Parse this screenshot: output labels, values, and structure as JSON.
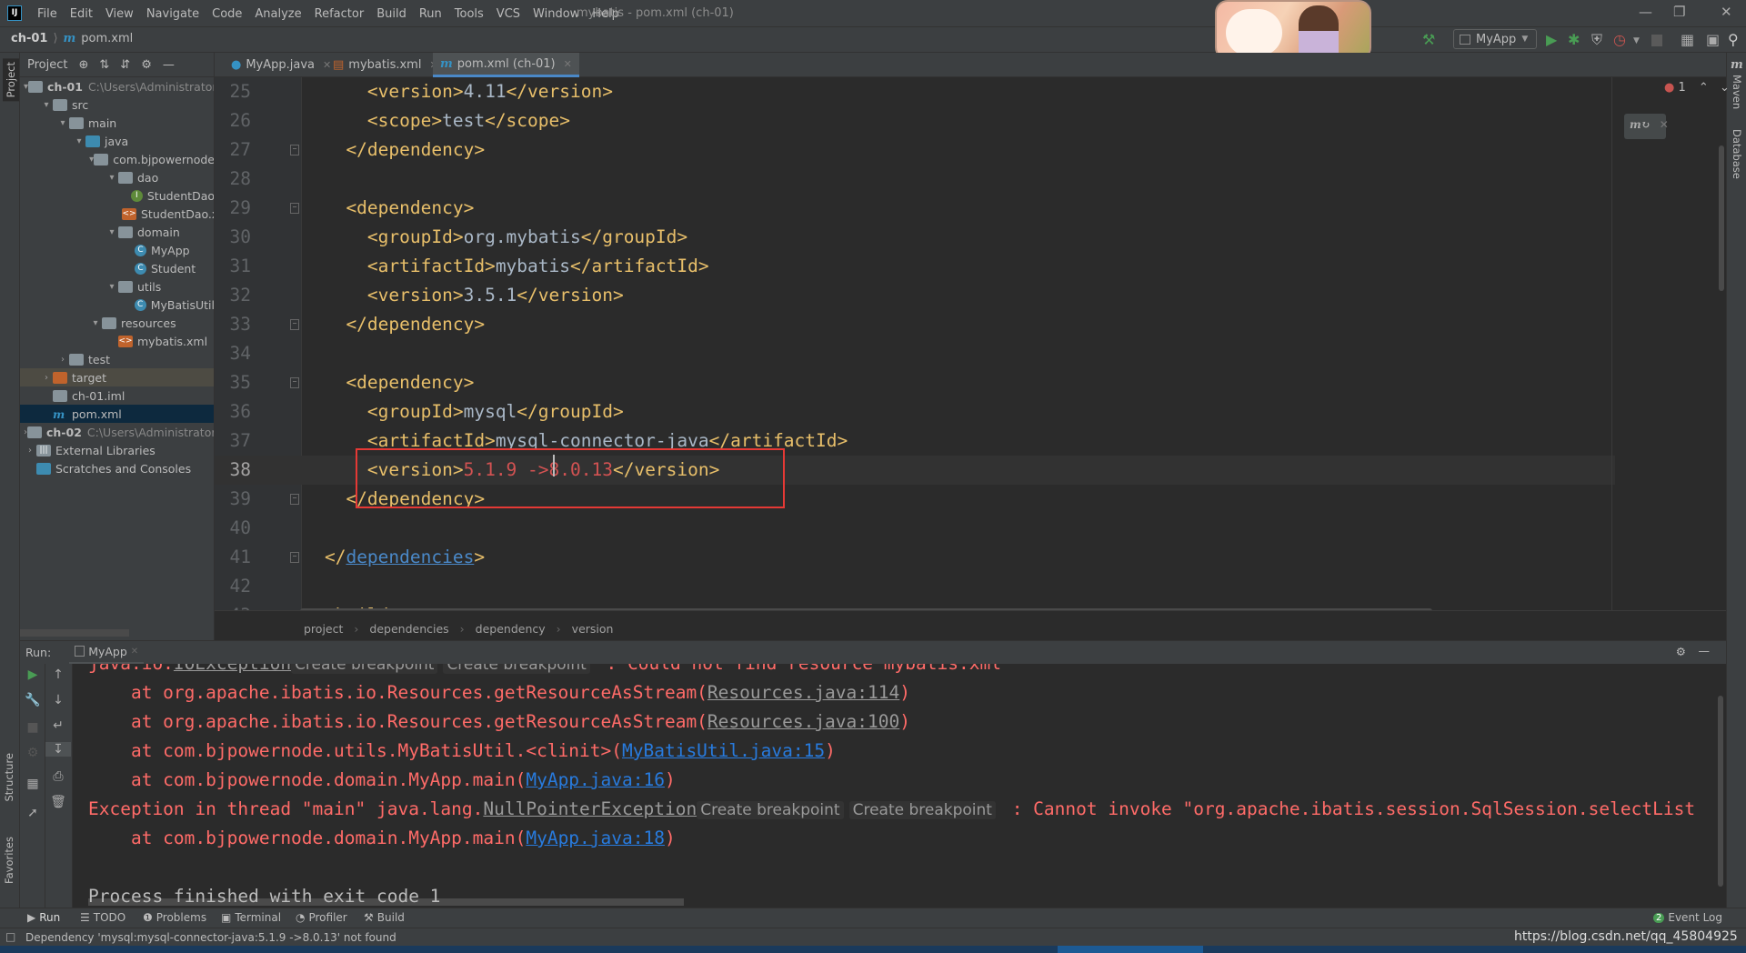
{
  "menubar": {
    "items": [
      "File",
      "Edit",
      "View",
      "Navigate",
      "Code",
      "Analyze",
      "Refactor",
      "Build",
      "Run",
      "Tools",
      "VCS",
      "Window",
      "Help"
    ],
    "title": "mybatis - pom.xml (ch-01)"
  },
  "navbar": {
    "project": "ch-01",
    "file": "pom.xml"
  },
  "toolbar": {
    "run_config": "MyApp"
  },
  "tool_tabs": {
    "project": "Project",
    "structure": "Structure",
    "favorites": "Favorites",
    "maven": "Maven",
    "database": "Database"
  },
  "editor_tabs": [
    {
      "label": "MyApp.java",
      "icon": "java-class-icon"
    },
    {
      "label": "mybatis.xml",
      "icon": "xml-file-icon"
    },
    {
      "label": "pom.xml (ch-01)",
      "icon": "maven-icon",
      "active": true
    }
  ],
  "project_tree": [
    {
      "label": "ch-01",
      "path": "C:\\Users\\Administrator",
      "level": 0,
      "expanded": true,
      "icon": "module",
      "bold": true
    },
    {
      "label": "src",
      "level": 1,
      "expanded": true,
      "icon": "folder"
    },
    {
      "label": "main",
      "level": 2,
      "expanded": true,
      "icon": "folder"
    },
    {
      "label": "java",
      "level": 3,
      "expanded": true,
      "icon": "src"
    },
    {
      "label": "com.bjpowernode",
      "level": 4,
      "expanded": true,
      "icon": "folder"
    },
    {
      "label": "dao",
      "level": 5,
      "expanded": true,
      "icon": "folder"
    },
    {
      "label": "StudentDao",
      "level": 6,
      "icon": "intf"
    },
    {
      "label": "StudentDao.xml",
      "level": 6,
      "icon": "xml"
    },
    {
      "label": "domain",
      "level": 5,
      "expanded": true,
      "icon": "folder"
    },
    {
      "label": "MyApp",
      "level": 6,
      "icon": "cls"
    },
    {
      "label": "Student",
      "level": 6,
      "icon": "cls"
    },
    {
      "label": "utils",
      "level": 5,
      "expanded": true,
      "icon": "folder"
    },
    {
      "label": "MyBatisUtil",
      "level": 6,
      "icon": "cls"
    },
    {
      "label": "resources",
      "level": 4,
      "expanded": true,
      "icon": "folder"
    },
    {
      "label": "mybatis.xml",
      "level": 5,
      "icon": "xml"
    },
    {
      "label": "test",
      "level": 2,
      "expanded": false,
      "icon": "folder"
    },
    {
      "label": "target",
      "level": 1,
      "expanded": false,
      "icon": "orange",
      "state": "excluded"
    },
    {
      "label": "ch-01.iml",
      "level": 1,
      "icon": "file"
    },
    {
      "label": "pom.xml",
      "level": 1,
      "icon": "maven",
      "state": "selected"
    },
    {
      "label": "ch-02",
      "path": "C:\\Users\\Administrator",
      "level": 0,
      "expanded": false,
      "icon": "module",
      "bold": true
    },
    {
      "label": "External Libraries",
      "level": 0,
      "expanded": false,
      "icon": "libs"
    },
    {
      "label": "Scratches and Consoles",
      "level": 0,
      "icon": "scratch"
    }
  ],
  "code_lines": [
    {
      "n": 25,
      "tokens": [
        [
          "tag",
          "        <version>"
        ],
        [
          "txt",
          "4.11"
        ],
        [
          "tag",
          "</version>"
        ]
      ]
    },
    {
      "n": 26,
      "tokens": [
        [
          "tag",
          "        <scope>"
        ],
        [
          "txt",
          "test"
        ],
        [
          "tag",
          "</scope>"
        ]
      ]
    },
    {
      "n": 27,
      "fold": true,
      "tokens": [
        [
          "tag",
          "      </dependency>"
        ]
      ]
    },
    {
      "n": 28,
      "tokens": []
    },
    {
      "n": 29,
      "fold": true,
      "tokens": [
        [
          "tag",
          "      <dependency>"
        ]
      ]
    },
    {
      "n": 30,
      "tokens": [
        [
          "tag",
          "        <groupId>"
        ],
        [
          "txt",
          "org.mybatis"
        ],
        [
          "tag",
          "</groupId>"
        ]
      ]
    },
    {
      "n": 31,
      "tokens": [
        [
          "tag",
          "        <artifactId>"
        ],
        [
          "txt",
          "mybatis"
        ],
        [
          "tag",
          "</artifactId>"
        ]
      ]
    },
    {
      "n": 32,
      "tokens": [
        [
          "tag",
          "        <version>"
        ],
        [
          "txt",
          "3.5.1"
        ],
        [
          "tag",
          "</version>"
        ]
      ]
    },
    {
      "n": 33,
      "fold": true,
      "tokens": [
        [
          "tag",
          "      </dependency>"
        ]
      ]
    },
    {
      "n": 34,
      "tokens": []
    },
    {
      "n": 35,
      "fold": true,
      "tokens": [
        [
          "tag",
          "      <dependency>"
        ]
      ]
    },
    {
      "n": 36,
      "tokens": [
        [
          "tag",
          "        <groupId>"
        ],
        [
          "txt",
          "mysql"
        ],
        [
          "tag",
          "</groupId>"
        ]
      ]
    },
    {
      "n": 37,
      "tokens": [
        [
          "tag",
          "        <artifactId>"
        ],
        [
          "txt",
          "mysql-connector-java"
        ],
        [
          "tag",
          "</artifactId>"
        ]
      ]
    },
    {
      "n": 38,
      "current": true,
      "tokens": [
        [
          "tag",
          "        <version>"
        ],
        [
          "bad",
          "5.1.9 ->8.0.13"
        ],
        [
          "tag",
          "</version>"
        ]
      ]
    },
    {
      "n": 39,
      "fold": true,
      "tokens": [
        [
          "tag",
          "      </dependency>"
        ]
      ]
    },
    {
      "n": 40,
      "tokens": []
    },
    {
      "n": 41,
      "fold": true,
      "tokens": [
        [
          "tag",
          "    </"
        ],
        [
          "lnk",
          "dependencies"
        ],
        [
          "tag",
          ">"
        ]
      ]
    },
    {
      "n": 42,
      "tokens": []
    },
    {
      "n": 43,
      "fold": true,
      "tokens": [
        [
          "tag",
          "    <build>"
        ]
      ]
    }
  ],
  "editor_status": {
    "error_count": "1"
  },
  "breadcrumbs": [
    "project",
    "dependencies",
    "dependency",
    "version"
  ],
  "run": {
    "label": "Run:",
    "tab": "MyApp"
  },
  "console_lines": [
    [
      [
        "err",
        "java.io."
      ],
      [
        "glink",
        "IOException"
      ],
      [
        "hint",
        "Create breakpoint"
      ],
      [
        "hint",
        "Create breakpoint"
      ],
      [
        "err",
        " : Could not find resource mybatis.xml"
      ]
    ],
    [
      [
        "err",
        "    at org.apache.ibatis.io.Resources.getResourceAsStream("
      ],
      [
        "glink",
        "Resources.java:114"
      ],
      [
        "err",
        ")"
      ]
    ],
    [
      [
        "err",
        "    at org.apache.ibatis.io.Resources.getResourceAsStream("
      ],
      [
        "glink",
        "Resources.java:100"
      ],
      [
        "err",
        ")"
      ]
    ],
    [
      [
        "err",
        "    at com.bjpowernode.utils.MyBatisUtil.<clinit>("
      ],
      [
        "blink",
        "MyBatisUtil.java:15"
      ],
      [
        "err",
        ")"
      ]
    ],
    [
      [
        "err",
        "    at com.bjpowernode.domain.MyApp.main("
      ],
      [
        "blink",
        "MyApp.java:16"
      ],
      [
        "err",
        ")"
      ]
    ],
    [
      [
        "err",
        "Exception in thread \"main\" java.lang."
      ],
      [
        "glink",
        "NullPointerException"
      ],
      [
        "hint",
        "Create breakpoint"
      ],
      [
        "hint",
        "Create breakpoint"
      ],
      [
        "err",
        " : Cannot invoke \"org.apache.ibatis.session.SqlSession.selectList"
      ]
    ],
    [
      [
        "err",
        "    at com.bjpowernode.domain.MyApp.main("
      ],
      [
        "blink",
        "MyApp.java:18"
      ],
      [
        "err",
        ")"
      ]
    ],
    [],
    [
      [
        "plain",
        "Process finished with exit code 1"
      ]
    ]
  ],
  "bottom_tabs": [
    "Run",
    "TODO",
    "Problems",
    "Terminal",
    "Profiler",
    "Build"
  ],
  "event_log": {
    "count": "2",
    "label": "Event Log"
  },
  "status": {
    "message": "Dependency 'mysql:mysql-connector-java:5.1.9 ->8.0.13' not found",
    "watermark": "https://blog.csdn.net/qq_45804925"
  },
  "colors": {
    "tag": "#e8bf6a",
    "text": "#a9b7c6",
    "error": "#ff6b68",
    "link": "#287bde",
    "accent": "#4a88c7",
    "highlight_box": "#e53935"
  }
}
